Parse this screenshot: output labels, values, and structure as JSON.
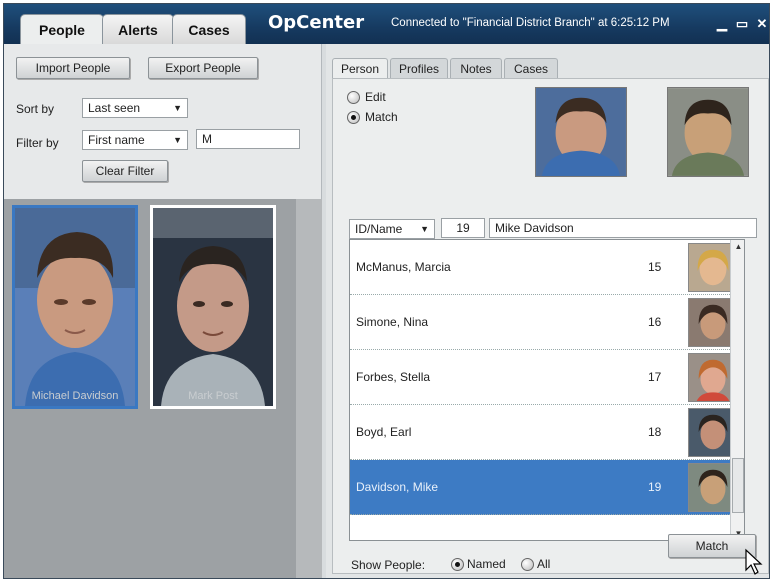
{
  "tabs": [
    "People",
    "Alerts",
    "Cases"
  ],
  "app_title": "OpCenter",
  "connection_status": "Connected to \"Financial District Branch\" at 6:25:12 PM",
  "window_buttons": {
    "minimize": "▁",
    "maximize": "▭",
    "close": "✕"
  },
  "left": {
    "import_label": "Import People",
    "export_label": "Export People",
    "sort_label": "Sort by",
    "sort_value": "Last seen",
    "filter_label": "Filter by",
    "filter_field": "First name",
    "filter_text": "M",
    "clear_filter_label": "Clear Filter",
    "gallery": [
      {
        "name": "Michael Davidson",
        "selected": true
      },
      {
        "name": "Mark Post",
        "selected": false
      }
    ]
  },
  "right": {
    "tabs": [
      "Person",
      "Profiles",
      "Notes",
      "Cases"
    ],
    "mode_edit": "Edit",
    "mode_match": "Match",
    "id_selector": "ID/Name",
    "id_value": "19",
    "name_value": "Mike Davidson",
    "list": [
      {
        "name": "McManus, Marcia",
        "id": "15",
        "selected": false
      },
      {
        "name": "Simone, Nina",
        "id": "16",
        "selected": false
      },
      {
        "name": "Forbes, Stella",
        "id": "17",
        "selected": false
      },
      {
        "name": "Boyd, Earl",
        "id": "18",
        "selected": false
      },
      {
        "name": "Davidson, Mike",
        "id": "19",
        "selected": true
      }
    ],
    "show_people_label": "Show People:",
    "show_named": "Named",
    "show_all": "All",
    "match_button": "Match"
  },
  "colors": {
    "titlebar": "#163a60",
    "selection": "#3d7bc4"
  }
}
